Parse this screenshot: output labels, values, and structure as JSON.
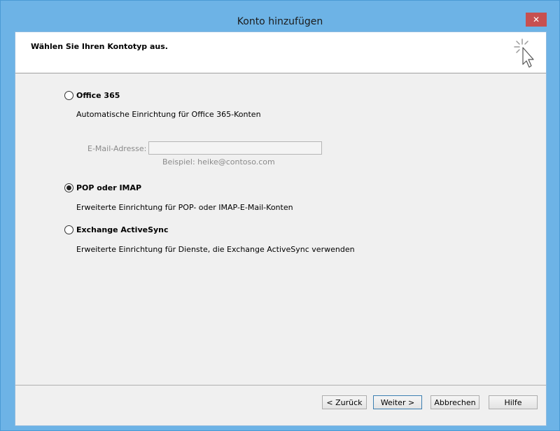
{
  "window": {
    "title": "Konto hinzufügen",
    "close_glyph": "✕"
  },
  "header": {
    "title": "Wählen Sie Ihren Kontotyp aus.",
    "icon": "wizard-cursor-icon"
  },
  "options": {
    "office365": {
      "label": "Office 365",
      "description": "Automatische Einrichtung für Office 365-Konten",
      "checked": false,
      "email_label": "E-Mail-Adresse:",
      "email_value": "",
      "email_example": "Beispiel: heike@contoso.com"
    },
    "pop_imap": {
      "label": "POP oder IMAP",
      "description": "Erweiterte Einrichtung für POP- oder IMAP-E-Mail-Konten",
      "checked": true
    },
    "exchange": {
      "label": "Exchange ActiveSync",
      "description": "Erweiterte Einrichtung für Dienste, die Exchange ActiveSync verwenden",
      "checked": false
    }
  },
  "buttons": {
    "back": "< Zurück",
    "next": "Weiter >",
    "cancel": "Abbrechen",
    "help": "Hilfe"
  },
  "colors": {
    "titlebar": "#6db3e6",
    "close": "#c75050",
    "client_bg": "#f0f0f0"
  }
}
